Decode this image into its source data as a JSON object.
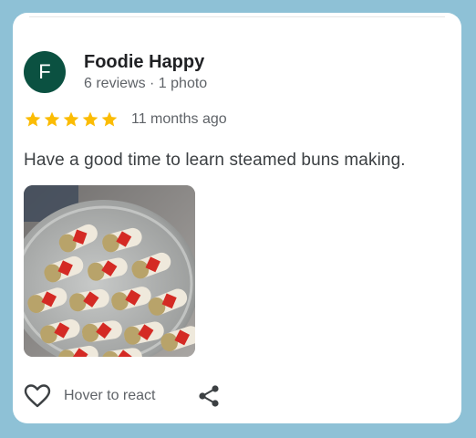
{
  "review": {
    "avatar_initial": "F",
    "author_name": "Foodie Happy",
    "author_meta": "6 reviews · 1 photo",
    "rating": 5,
    "rating_max": 5,
    "time_ago": "11 months ago",
    "text": "Have a good time to learn steamed buns making.",
    "photo_icon": "photo-steamed-buns"
  },
  "actions": {
    "react_label": "Hover to react",
    "react_icon": "heart-outline-icon",
    "share_icon": "share-icon"
  },
  "colors": {
    "avatar_bg": "#0b5141",
    "star": "#fbbc04",
    "frame": "#8ec1d6"
  }
}
